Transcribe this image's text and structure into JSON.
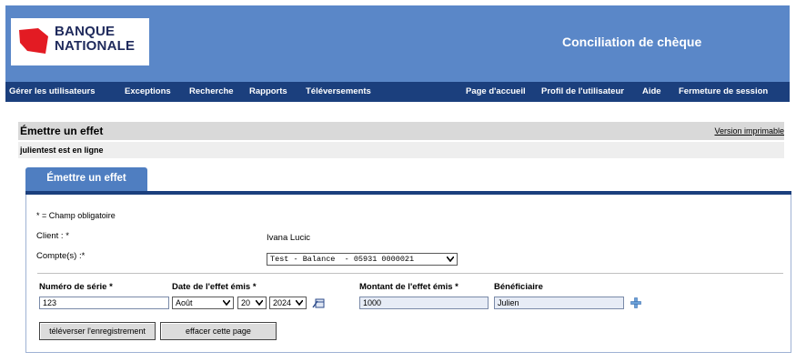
{
  "brand": {
    "line1": "BANQUE",
    "line2": "NATIONALE",
    "logo_color": "#e31b23"
  },
  "header": {
    "app_title": "Conciliation de chèque",
    "bg_color": "#5a87c8"
  },
  "nav": {
    "bg_color": "#1b3f7d",
    "left_items": [
      "Gérer les utilisateurs",
      "Exceptions",
      "Recherche",
      "Rapports",
      "Téléversements"
    ],
    "right_items": [
      "Page d'accueil",
      "Profil de l'utilisateur",
      "Aide",
      "Fermeture de session"
    ]
  },
  "page": {
    "title": "Émettre un effet",
    "print_link": "Version imprimable",
    "online_status": "julientest est en ligne"
  },
  "tab": {
    "label": "Émettre un effet"
  },
  "form": {
    "required_note": "* = Champ obligatoire",
    "client_label": "Client : *",
    "client_value": "Ivana Lucic",
    "accounts_label": "Compte(s) :*",
    "accounts_selected": "Test - Balance  - 05931 0000021",
    "serial_label": "Numéro de série *",
    "serial_value": "123",
    "date_label": "Date de l'effet émis *",
    "month_selected": "Août",
    "day_selected": "20",
    "year_selected": "2024",
    "amount_label": "Montant de l'effet émis *",
    "amount_value": "1000",
    "beneficiary_label": "Bénéficiaire",
    "beneficiary_value": "Julien",
    "upload_button": "téléverser l'enregistrement",
    "clear_button": "effacer cette page"
  }
}
